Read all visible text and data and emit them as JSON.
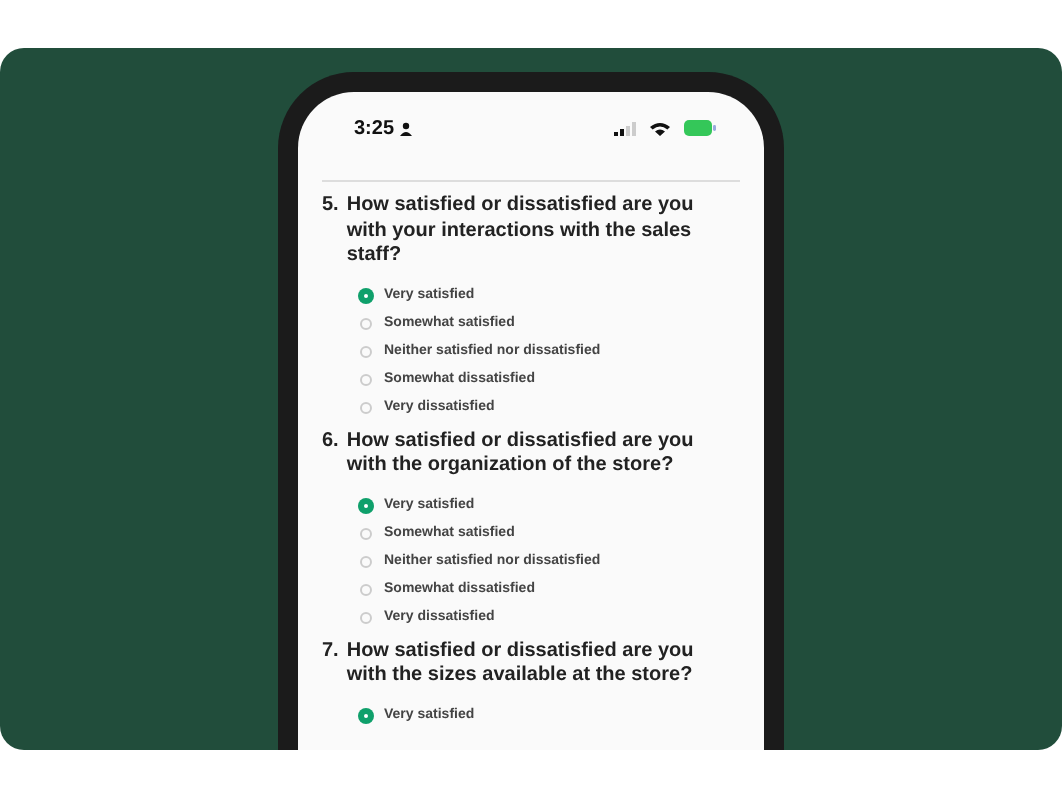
{
  "status_bar": {
    "time": "3:25"
  },
  "questions": [
    {
      "number": "5.",
      "text": "How satisfied or dissatisfied are you with your interactions with the sales staff?",
      "options": [
        {
          "label": "Very satisfied",
          "selected": true
        },
        {
          "label": "Somewhat satisfied",
          "selected": false
        },
        {
          "label": "Neither satisfied nor dissatisfied",
          "selected": false
        },
        {
          "label": "Somewhat dissatisfied",
          "selected": false
        },
        {
          "label": "Very dissatisfied",
          "selected": false
        }
      ]
    },
    {
      "number": "6.",
      "text": "How satisfied or dissatisfied are you with the organization of the store?",
      "options": [
        {
          "label": "Very satisfied",
          "selected": true
        },
        {
          "label": "Somewhat satisfied",
          "selected": false
        },
        {
          "label": "Neither satisfied nor dissatisfied",
          "selected": false
        },
        {
          "label": "Somewhat dissatisfied",
          "selected": false
        },
        {
          "label": "Very dissatisfied",
          "selected": false
        }
      ]
    },
    {
      "number": "7.",
      "text": "How satisfied or dissatisfied are you with the sizes available at the store?",
      "options": [
        {
          "label": "Very satisfied",
          "selected": true
        }
      ]
    }
  ]
}
